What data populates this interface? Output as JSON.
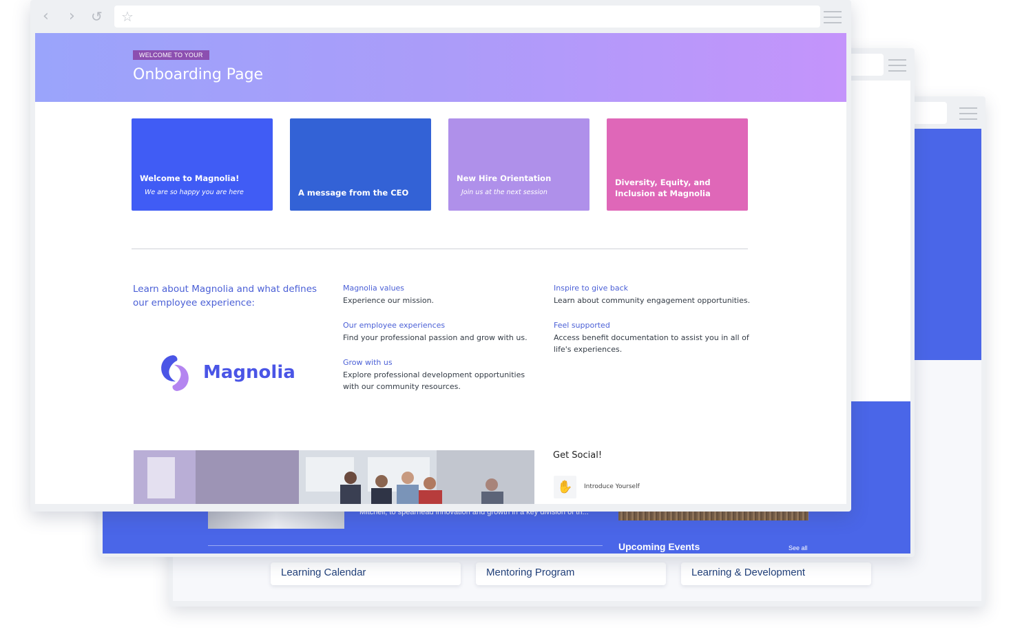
{
  "front": {
    "hero": {
      "badge": "WELCOME TO YOUR",
      "title": "Onboarding Page"
    },
    "tiles": [
      {
        "title": "Welcome to Magnolia!",
        "subtitle": "We are so happy you are here",
        "color": "#405cf5"
      },
      {
        "title": "A message from the CEO",
        "subtitle": "",
        "color": "#3362d6"
      },
      {
        "title": "New Hire Orientation",
        "subtitle": "Join us at the next session",
        "color": "#af90ea"
      },
      {
        "title": "Diversity, Equity, and Inclusion at Magnolia",
        "subtitle": "",
        "color": "#df67b8"
      }
    ],
    "learn_heading": "Learn about Magnolia and what defines our employee experience:",
    "logo_text": "Magnolia",
    "links": [
      {
        "title": "Magnolia values",
        "desc": "Experience our mission."
      },
      {
        "title": "Our employee experiences",
        "desc": "Find your professional passion and grow with us."
      },
      {
        "title": "Grow with us",
        "desc": "Explore professional development opportunities with our community resources."
      },
      {
        "title": "Inspire to give back",
        "desc": "Learn about community engagement opportunities."
      },
      {
        "title": "Feel supported",
        "desc": "Access benefit documentation to assist you in all of life's experiences."
      }
    ],
    "social": {
      "title": "Get Social!",
      "item_label": "Introduce Yourself",
      "item_icon": "waving-hand-icon"
    }
  },
  "middle": {
    "snippet": "Mitchell, to spearhead innovation and growth in a key division of th...",
    "events_title": "Upcoming Events",
    "see_all": "See all"
  },
  "back": {
    "cards": [
      "Learning Calendar",
      "Mentoring Program",
      "Learning & Development"
    ]
  },
  "colors": {
    "accent": "#4a5fd6",
    "brand_blue": "#4a66e8",
    "hero_start": "#9aa4fb",
    "hero_end": "#c494fb"
  }
}
